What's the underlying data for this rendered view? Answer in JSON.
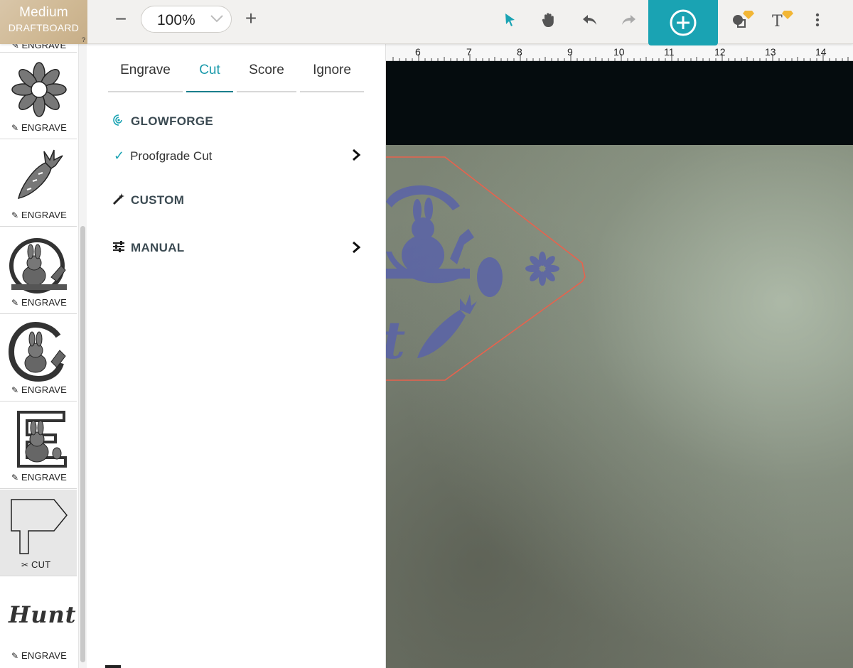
{
  "material": {
    "name": "Medium",
    "type": "DRAFTBOARD",
    "help": "?"
  },
  "toolbar": {
    "zoom_value": "100%",
    "zoom_out_label": "−",
    "zoom_in_label": "+",
    "tools": [
      "select-arrow-icon",
      "pan-hand-icon",
      "undo-icon",
      "redo-icon",
      "add-circle-icon",
      "shapes-premium-icon",
      "text-premium-icon",
      "more-vertical-icon"
    ],
    "accent_color": "#1aa3b3"
  },
  "strip": {
    "partial_label": "ENGRAVE",
    "items": [
      {
        "art": "flower",
        "label": "ENGRAVE",
        "mode_icon": "pencil-icon"
      },
      {
        "art": "carrot",
        "label": "ENGRAVE",
        "mode_icon": "pencil-icon"
      },
      {
        "art": "bunny-circle",
        "label": "ENGRAVE",
        "mode_icon": "pencil-icon"
      },
      {
        "art": "bunny-letter-g",
        "label": "ENGRAVE",
        "mode_icon": "pencil-icon"
      },
      {
        "art": "bunny-letter-e",
        "label": "ENGRAVE",
        "mode_icon": "pencil-icon"
      },
      {
        "art": "sign-post",
        "label": "CUT",
        "mode_icon": "scissors-icon",
        "active": true
      },
      {
        "art": "hunt-text",
        "art_text": "Hunt",
        "label": "ENGRAVE",
        "mode_icon": "pencil-icon"
      }
    ]
  },
  "panel": {
    "tabs": [
      {
        "label": "Engrave"
      },
      {
        "label": "Cut",
        "active": true
      },
      {
        "label": "Score"
      },
      {
        "label": "Ignore"
      }
    ],
    "sections": {
      "glowforge": "GLOWFORGE",
      "proofgrade_option": "Proofgrade Cut",
      "custom": "CUSTOM",
      "manual": "MANUAL"
    }
  },
  "ruler": {
    "ticks": [
      "6",
      "7",
      "8",
      "9",
      "10",
      "11",
      "12",
      "13",
      "14"
    ]
  },
  "canvas": {
    "art_text": "t",
    "cut_color": "#e8624d",
    "engrave_color": "#5a63a8"
  }
}
